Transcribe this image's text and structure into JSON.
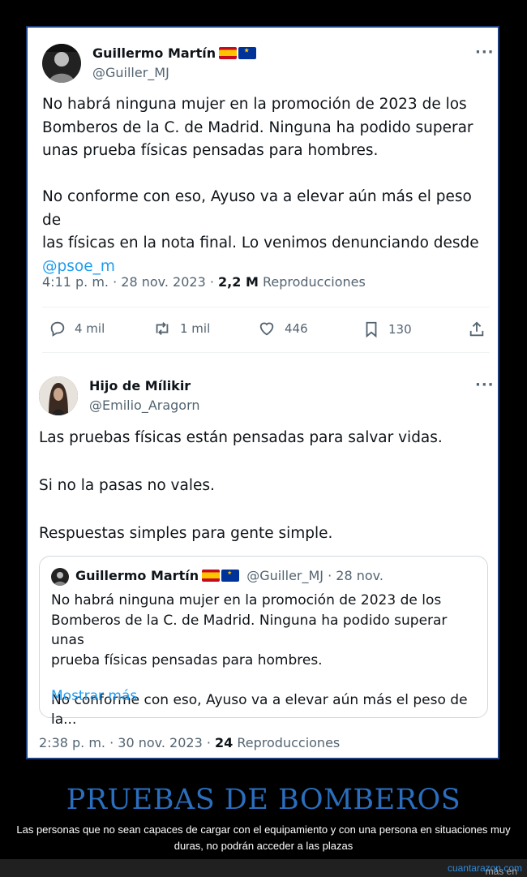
{
  "tweet1": {
    "name": "Guillermo Martín",
    "handle": "@Guiller_MJ",
    "text": "No habrá ninguna mujer en la promoción de 2023 de los\nBomberos de la C. de Madrid. Ninguna ha podido superar\nunas prueba físicas pensadas para hombres.\n\nNo conforme con eso, Ayuso va a elevar aún más el peso de\nlas físicas en la nota final. Lo venimos denunciando desde",
    "mention": "@psoe_m",
    "time": "4:11 p. m. · 28 nov. 2023 ·",
    "views_count": "2,2 M",
    "views_label": "Reproducciones",
    "replies": "4 mil",
    "retweets": "1 mil",
    "likes": "446",
    "bookmarks": "130"
  },
  "tweet2": {
    "name": "Hijo de Mílikir",
    "handle": "@Emilio_Aragorn",
    "line1": "Las pruebas físicas están pensadas para salvar vidas.",
    "line2": "Si no la pasas no vales.",
    "line3": "Respuestas simples para gente simple.",
    "time": "2:38 p. m. · 30 nov. 2023 ·",
    "views_count": "24",
    "views_label": "Reproducciones"
  },
  "quoted": {
    "name": "Guillermo Martín",
    "handle_date": "@Guiller_MJ · 28 nov.",
    "text": "No habrá ninguna mujer en la promoción de 2023 de los\nBomberos de la C. de Madrid. Ninguna ha podido superar unas\nprueba físicas pensadas para hombres.\n\nNo conforme con eso, Ayuso va a elevar aún más el peso de la...",
    "show_more": "Mostrar más"
  },
  "headline": "PRUEBAS DE BOMBEROS",
  "caption": "Las personas que no sean capaces de cargar con el equipamiento y con una persona en situaciones muy duras, no podrán acceder a las plazas",
  "footer": {
    "prefix": "más en",
    "site": "cuantarazon.com"
  },
  "colors": {
    "link": "#1d9bf0",
    "headline": "#2a6ebd",
    "frame_border": "#1e3f7a"
  }
}
